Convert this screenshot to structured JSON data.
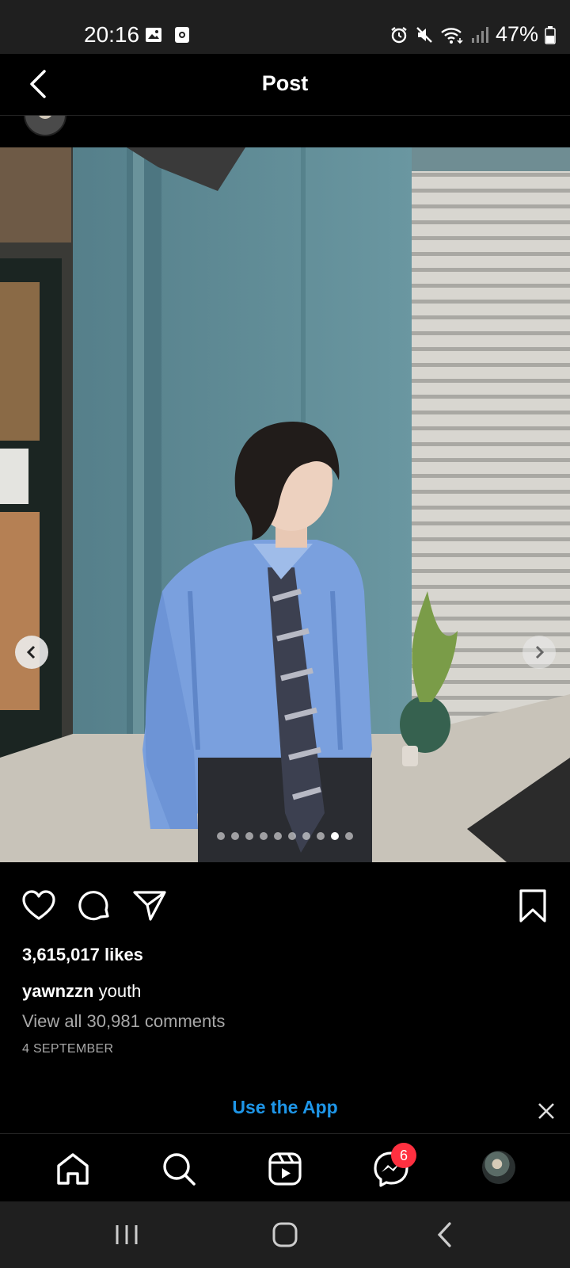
{
  "status_bar": {
    "time": "20:16",
    "battery": "47%",
    "icons": [
      "gallery-icon",
      "screenshot-icon",
      "alarm-icon",
      "mute-icon",
      "wifi-icon",
      "signal-icon",
      "battery-icon"
    ]
  },
  "header": {
    "title": "Post"
  },
  "carousel": {
    "total": 10,
    "active_index": 8
  },
  "post": {
    "likes": "3,615,017 likes",
    "username": "yawnzzn",
    "caption": "youth",
    "view_comments": "View all 30,981 comments",
    "date": "4 SEPTEMBER"
  },
  "banner": {
    "label": "Use the App"
  },
  "bottom_nav": {
    "items": [
      "home-icon",
      "search-icon",
      "reels-icon",
      "messenger-icon",
      "profile-avatar"
    ],
    "messenger_badge": "6"
  },
  "colors": {
    "accent": "#1e96e8",
    "badge": "#ff3040",
    "background": "#000000"
  }
}
